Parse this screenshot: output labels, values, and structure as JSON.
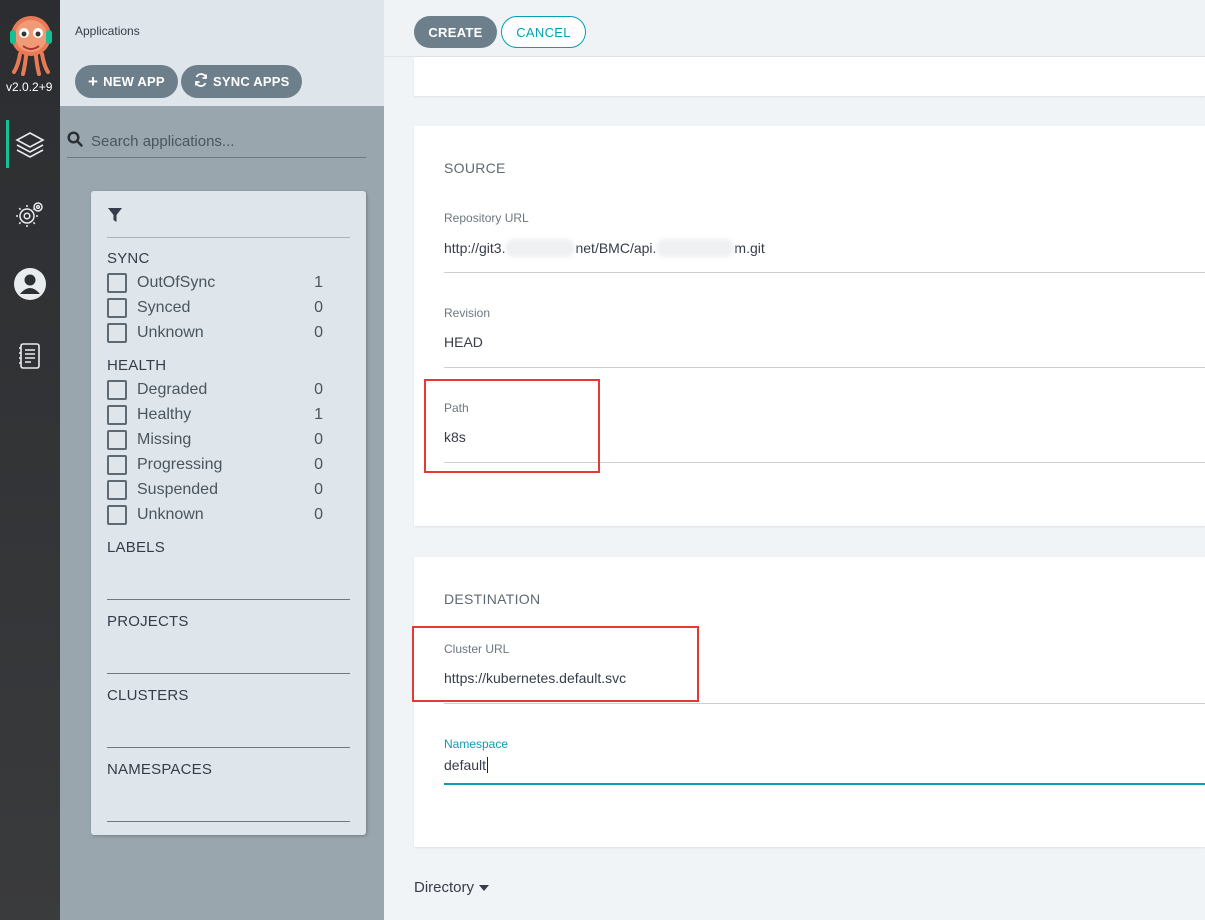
{
  "app": {
    "version": "v2.0.2+9"
  },
  "apps_panel": {
    "title": "Applications",
    "new_app_label": "NEW APP",
    "sync_apps_label": "SYNC APPS",
    "search_placeholder": "Search applications..."
  },
  "filters": {
    "sync": {
      "title": "SYNC",
      "items": [
        {
          "label": "OutOfSync",
          "count": "1"
        },
        {
          "label": "Synced",
          "count": "0"
        },
        {
          "label": "Unknown",
          "count": "0"
        }
      ]
    },
    "health": {
      "title": "HEALTH",
      "items": [
        {
          "label": "Degraded",
          "count": "0"
        },
        {
          "label": "Healthy",
          "count": "1"
        },
        {
          "label": "Missing",
          "count": "0"
        },
        {
          "label": "Progressing",
          "count": "0"
        },
        {
          "label": "Suspended",
          "count": "0"
        },
        {
          "label": "Unknown",
          "count": "0"
        }
      ]
    },
    "labels_title": "LABELS",
    "projects_title": "PROJECTS",
    "clusters_title": "CLUSTERS",
    "namespaces_title": "NAMESPACES"
  },
  "form": {
    "create_label": "CREATE",
    "cancel_label": "CANCEL",
    "source": {
      "title": "SOURCE",
      "repo_label": "Repository URL",
      "repo_part1": "http://git3.",
      "repo_part2": "net/BMC/api.",
      "repo_part3": "m.git",
      "revision_label": "Revision",
      "revision_value": "HEAD",
      "path_label": "Path",
      "path_value": "k8s"
    },
    "destination": {
      "title": "DESTINATION",
      "cluster_label": "Cluster URL",
      "cluster_value": "https://kubernetes.default.svc",
      "namespace_label": "Namespace",
      "namespace_value": "default"
    },
    "directory_label": "Directory"
  },
  "colors": {
    "accent": "#0e9db0",
    "highlight": "#e53935",
    "button_gray": "#6d7f8b",
    "sidebar_active": "#18be94"
  }
}
